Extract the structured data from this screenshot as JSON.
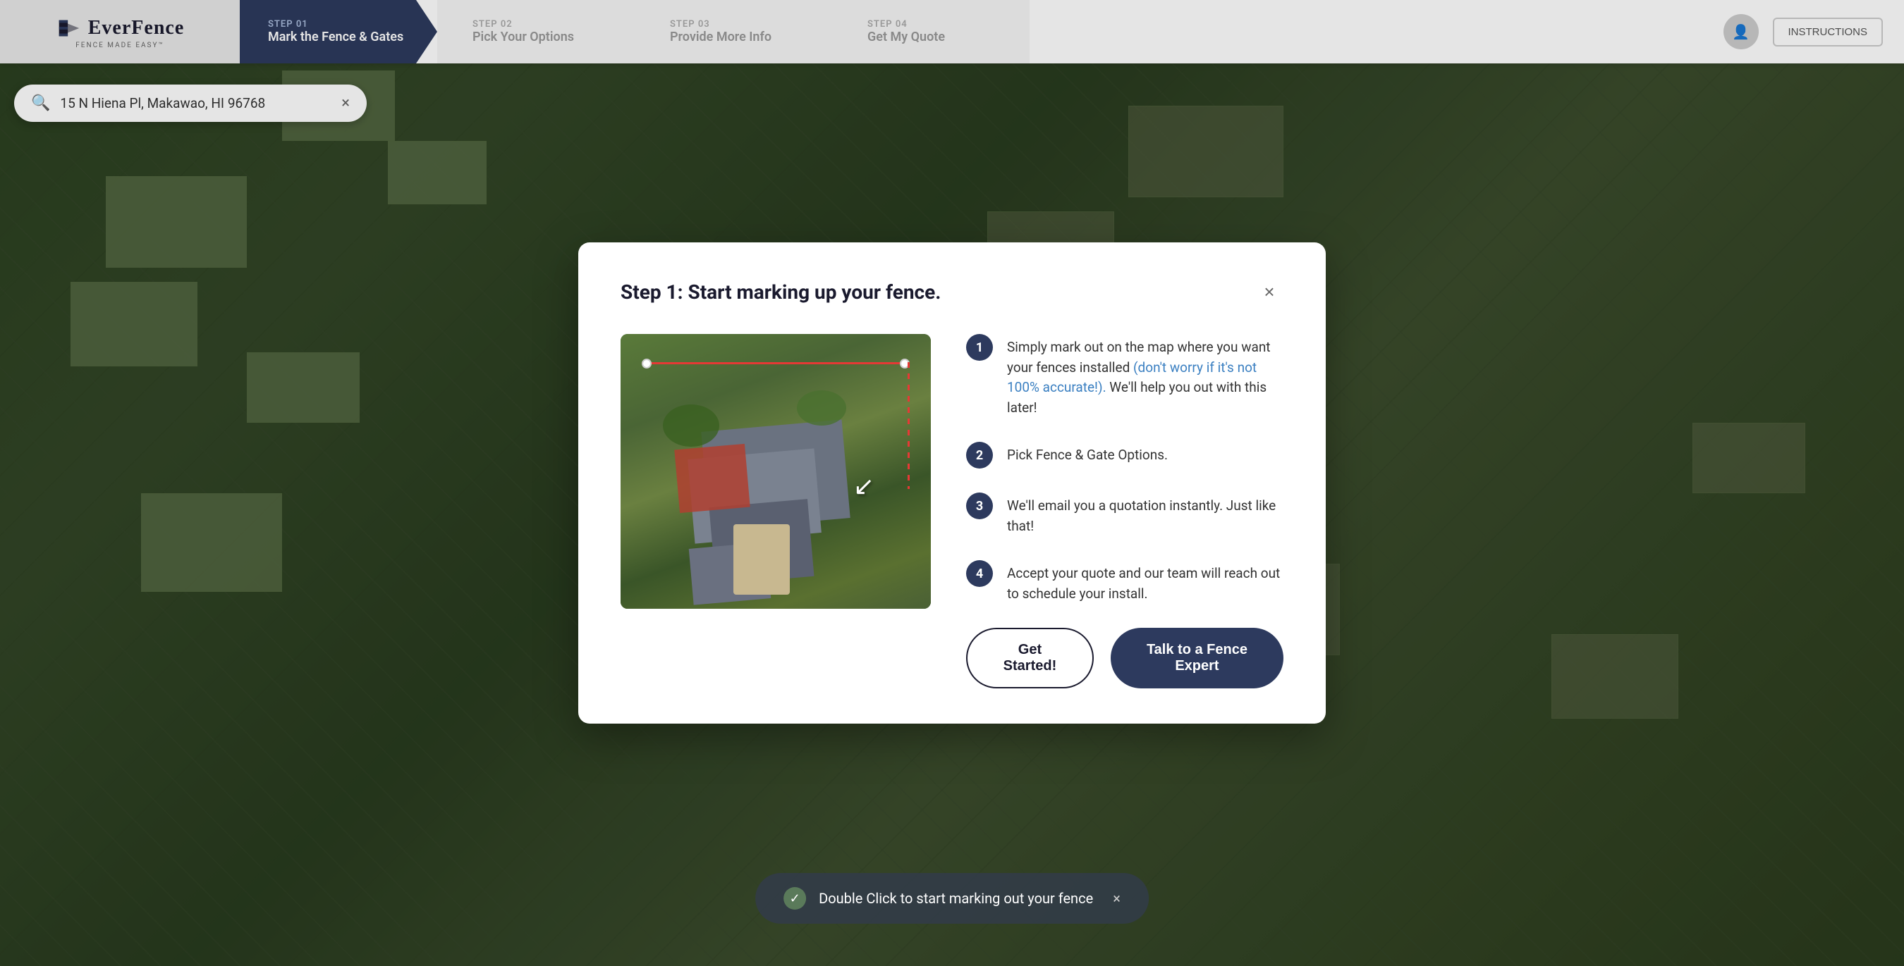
{
  "header": {
    "logo": {
      "brand": "EverFence",
      "tagline": "FENCE MADE EASY™"
    },
    "steps": [
      {
        "num": "STEP 01",
        "label": "Mark the Fence & Gates",
        "active": true
      },
      {
        "num": "STEP 02",
        "label": "Pick Your Options",
        "active": false
      },
      {
        "num": "STEP 03",
        "label": "Provide More Info",
        "active": false
      },
      {
        "num": "STEP 04",
        "label": "Get My Quote",
        "active": false
      }
    ],
    "instructions_label": "INSTRUCTIONS"
  },
  "search": {
    "placeholder": "15 N Hiena Pl, Makawao, HI 96768",
    "clear_icon": "×"
  },
  "modal": {
    "title": "Step 1: Start marking up your fence.",
    "close_icon": "×",
    "steps": [
      {
        "num": "1",
        "text_before": "Simply mark out on the map where you want your fences installed ",
        "text_link": "(don't worry if it's not 100% accurate!).",
        "text_after": " We'll help you out with this later!"
      },
      {
        "num": "2",
        "text": "Pick Fence & Gate Options."
      },
      {
        "num": "3",
        "text": "We'll email you a quotation instantly. Just like that!"
      },
      {
        "num": "4",
        "text": "Accept your quote and our team will reach out to schedule your install."
      }
    ],
    "buttons": {
      "get_started": "Get Started!",
      "talk_expert": "Talk to a Fence Expert"
    }
  },
  "toast": {
    "text": "Double Click to start marking out your fence",
    "close_icon": "×"
  },
  "colors": {
    "navy": "#2d3a5e",
    "link_blue": "#3a7fc1",
    "accent_red": "#e53935",
    "white": "#ffffff"
  }
}
